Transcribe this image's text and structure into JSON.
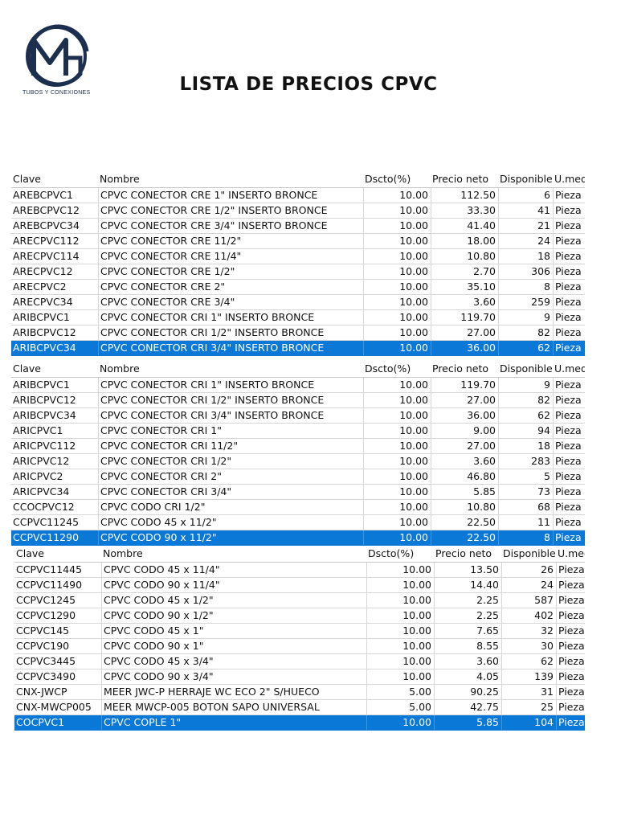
{
  "brand": {
    "logo_text": "MG",
    "logo_caption": "TUBOS Y CONEXIONES",
    "logo_color": "#1d2f4f"
  },
  "page": {
    "title": "LISTA DE PRECIOS CPVC"
  },
  "table_header": {
    "clave": "Clave",
    "nombre": "Nombre",
    "dscto": "Dscto(%)",
    "precio": "Precio neto",
    "disponible": "Disponible",
    "umed": "U.med"
  },
  "accent": "#0a78d7",
  "tables": [
    {
      "rows": [
        {
          "clave": "AREBCPVC1",
          "nombre": "CPVC CONECTOR CRE 1\" INSERTO BRONCE",
          "dscto": "10.00",
          "precio": "112.50",
          "disponible": "6",
          "umed": "Pieza"
        },
        {
          "clave": "AREBCPVC12",
          "nombre": "CPVC CONECTOR CRE 1/2\" INSERTO BRONCE",
          "dscto": "10.00",
          "precio": "33.30",
          "disponible": "41",
          "umed": "Pieza"
        },
        {
          "clave": "AREBCPVC34",
          "nombre": "CPVC CONECTOR CRE 3/4\" INSERTO BRONCE",
          "dscto": "10.00",
          "precio": "41.40",
          "disponible": "21",
          "umed": "Pieza"
        },
        {
          "clave": "ARECPVC112",
          "nombre": "CPVC CONECTOR CRE 11/2\"",
          "dscto": "10.00",
          "precio": "18.00",
          "disponible": "24",
          "umed": "Pieza"
        },
        {
          "clave": "ARECPVC114",
          "nombre": "CPVC CONECTOR CRE 11/4\"",
          "dscto": "10.00",
          "precio": "10.80",
          "disponible": "18",
          "umed": "Pieza"
        },
        {
          "clave": "ARECPVC12",
          "nombre": "CPVC CONECTOR CRE 1/2\"",
          "dscto": "10.00",
          "precio": "2.70",
          "disponible": "306",
          "umed": "Pieza"
        },
        {
          "clave": "ARECPVC2",
          "nombre": "CPVC CONECTOR CRE 2\"",
          "dscto": "10.00",
          "precio": "35.10",
          "disponible": "8",
          "umed": "Pieza"
        },
        {
          "clave": "ARECPVC34",
          "nombre": "CPVC CONECTOR CRE 3/4\"",
          "dscto": "10.00",
          "precio": "3.60",
          "disponible": "259",
          "umed": "Pieza"
        },
        {
          "clave": "ARIBCPVC1",
          "nombre": "CPVC CONECTOR CRI 1\" INSERTO BRONCE",
          "dscto": "10.00",
          "precio": "119.70",
          "disponible": "9",
          "umed": "Pieza"
        },
        {
          "clave": "ARIBCPVC12",
          "nombre": "CPVC CONECTOR CRI 1/2\" INSERTO BRONCE",
          "dscto": "10.00",
          "precio": "27.00",
          "disponible": "82",
          "umed": "Pieza"
        },
        {
          "clave": "ARIBCPVC34",
          "nombre": "CPVC CONECTOR CRI 3/4\" INSERTO BRONCE",
          "dscto": "10.00",
          "precio": "36.00",
          "disponible": "62",
          "umed": "Pieza",
          "selected": true
        }
      ]
    },
    {
      "rows": [
        {
          "clave": "ARIBCPVC1",
          "nombre": "CPVC CONECTOR CRI 1\" INSERTO BRONCE",
          "dscto": "10.00",
          "precio": "119.70",
          "disponible": "9",
          "umed": "Pieza"
        },
        {
          "clave": "ARIBCPVC12",
          "nombre": "CPVC CONECTOR CRI 1/2\" INSERTO BRONCE",
          "dscto": "10.00",
          "precio": "27.00",
          "disponible": "82",
          "umed": "Pieza"
        },
        {
          "clave": "ARIBCPVC34",
          "nombre": "CPVC CONECTOR CRI 3/4\" INSERTO BRONCE",
          "dscto": "10.00",
          "precio": "36.00",
          "disponible": "62",
          "umed": "Pieza"
        },
        {
          "clave": "ARICPVC1",
          "nombre": "CPVC CONECTOR CRI 1\"",
          "dscto": "10.00",
          "precio": "9.00",
          "disponible": "94",
          "umed": "Pieza"
        },
        {
          "clave": "ARICPVC112",
          "nombre": "CPVC CONECTOR CRI 11/2\"",
          "dscto": "10.00",
          "precio": "27.00",
          "disponible": "18",
          "umed": "Pieza"
        },
        {
          "clave": "ARICPVC12",
          "nombre": "CPVC CONECTOR CRI 1/2\"",
          "dscto": "10.00",
          "precio": "3.60",
          "disponible": "283",
          "umed": "Pieza"
        },
        {
          "clave": "ARICPVC2",
          "nombre": "CPVC CONECTOR CRI 2\"",
          "dscto": "10.00",
          "precio": "46.80",
          "disponible": "5",
          "umed": "Pieza"
        },
        {
          "clave": "ARICPVC34",
          "nombre": "CPVC CONECTOR CRI 3/4\"",
          "dscto": "10.00",
          "precio": "5.85",
          "disponible": "73",
          "umed": "Pieza"
        },
        {
          "clave": "CCOCPVC12",
          "nombre": "CPVC CODO CRI 1/2\"",
          "dscto": "10.00",
          "precio": "10.80",
          "disponible": "68",
          "umed": "Pieza"
        },
        {
          "clave": "CCPVC11245",
          "nombre": "CPVC CODO 45 x 11/2\"",
          "dscto": "10.00",
          "precio": "22.50",
          "disponible": "11",
          "umed": "Pieza"
        },
        {
          "clave": "CCPVC11290",
          "nombre": "CPVC CODO 90 x 11/2\"",
          "dscto": "10.00",
          "precio": "22.50",
          "disponible": "8",
          "umed": "Pieza",
          "selected": true
        }
      ]
    },
    {
      "rows": [
        {
          "clave": "CCPVC11445",
          "nombre": "CPVC CODO 45 x 11/4\"",
          "dscto": "10.00",
          "precio": "13.50",
          "disponible": "26",
          "umed": "Pieza"
        },
        {
          "clave": "CCPVC11490",
          "nombre": "CPVC CODO 90 x 11/4\"",
          "dscto": "10.00",
          "precio": "14.40",
          "disponible": "24",
          "umed": "Pieza"
        },
        {
          "clave": "CCPVC1245",
          "nombre": "CPVC CODO 45 x 1/2\"",
          "dscto": "10.00",
          "precio": "2.25",
          "disponible": "587",
          "umed": "Pieza"
        },
        {
          "clave": "CCPVC1290",
          "nombre": "CPVC CODO 90 x 1/2\"",
          "dscto": "10.00",
          "precio": "2.25",
          "disponible": "402",
          "umed": "Pieza"
        },
        {
          "clave": "CCPVC145",
          "nombre": "CPVC CODO 45 x 1\"",
          "dscto": "10.00",
          "precio": "7.65",
          "disponible": "32",
          "umed": "Pieza"
        },
        {
          "clave": "CCPVC190",
          "nombre": "CPVC CODO 90 x 1\"",
          "dscto": "10.00",
          "precio": "8.55",
          "disponible": "30",
          "umed": "Pieza"
        },
        {
          "clave": "CCPVC3445",
          "nombre": "CPVC CODO 45 x 3/4\"",
          "dscto": "10.00",
          "precio": "3.60",
          "disponible": "62",
          "umed": "Pieza"
        },
        {
          "clave": "CCPVC3490",
          "nombre": "CPVC CODO 90 x 3/4\"",
          "dscto": "10.00",
          "precio": "4.05",
          "disponible": "139",
          "umed": "Pieza"
        },
        {
          "clave": "CNX-JWCP",
          "nombre": "MEER JWC-P HERRAJE WC ECO 2\" S/HUECO",
          "dscto": "5.00",
          "precio": "90.25",
          "disponible": "31",
          "umed": "Pieza"
        },
        {
          "clave": "CNX-MWCP005",
          "nombre": "MEER MWCP-005 BOTON SAPO UNIVERSAL",
          "dscto": "5.00",
          "precio": "42.75",
          "disponible": "25",
          "umed": "Pieza"
        },
        {
          "clave": "COCPVC1",
          "nombre": "CPVC COPLE 1\"",
          "dscto": "10.00",
          "precio": "5.85",
          "disponible": "104",
          "umed": "Pieza",
          "selected": true
        }
      ]
    }
  ]
}
